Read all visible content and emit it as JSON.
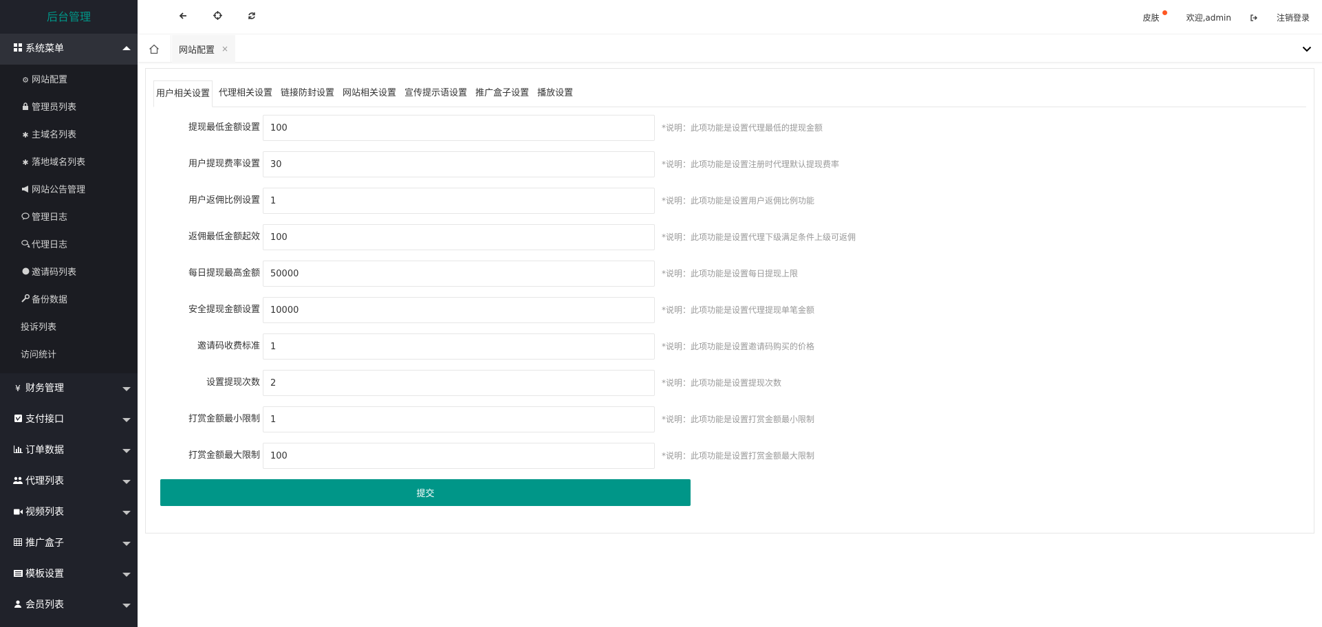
{
  "app": {
    "title": "后台管理"
  },
  "colors": {
    "accent": "#009688",
    "sidebar_bg": "#20222a",
    "badge": "#ff5722"
  },
  "sidebar": {
    "system_menu": {
      "label": "系统菜单",
      "icon": "grid-icon",
      "items": [
        {
          "label": "网站配置",
          "icon": "gears-icon"
        },
        {
          "label": "管理员列表",
          "icon": "lock-icon"
        },
        {
          "label": "主域名列表",
          "icon": "gear-icon"
        },
        {
          "label": "落地域名列表",
          "icon": "gear-icon"
        },
        {
          "label": "网站公告管理",
          "icon": "bullhorn-icon"
        },
        {
          "label": "管理日志",
          "icon": "comment-icon"
        },
        {
          "label": "代理日志",
          "icon": "comments-icon"
        },
        {
          "label": "邀请码列表",
          "icon": "circle-icon"
        },
        {
          "label": "备份数据",
          "icon": "wrench-icon"
        },
        {
          "label": "投诉列表",
          "icon": ""
        },
        {
          "label": "访问统计",
          "icon": ""
        }
      ]
    },
    "groups": [
      {
        "label": "财务管理",
        "icon": "yen-icon"
      },
      {
        "label": "支付接口",
        "icon": "vimeo-icon"
      },
      {
        "label": "订单数据",
        "icon": "bar-chart-icon"
      },
      {
        "label": "代理列表",
        "icon": "users-icon"
      },
      {
        "label": "视频列表",
        "icon": "video-camera-icon"
      },
      {
        "label": "推广盒子",
        "icon": "table-icon"
      },
      {
        "label": "模板设置",
        "icon": "list-alt-icon"
      },
      {
        "label": "会员列表",
        "icon": "user-icon"
      }
    ]
  },
  "header": {
    "back_icon": "arrow-left-icon",
    "crosshairs_icon": "crosshairs-icon",
    "refresh_icon": "refresh-icon",
    "skin_label": "皮肤",
    "welcome_label": "欢迎,admin",
    "logout_label": "注销登录"
  },
  "tabbar": {
    "home_icon": "home-icon",
    "active_tab": "网站配置",
    "close_glyph": "×"
  },
  "config": {
    "tabs": [
      "用户相关设置",
      "代理相关设置",
      "链接防封设置",
      "网站相关设置",
      "宣传提示语设置",
      "推广盒子设置",
      "播放设置"
    ],
    "active_tab_index": 0,
    "fields": [
      {
        "label": "提现最低金额设置",
        "value": "100",
        "tip": "*说明：此项功能是设置代理最低的提现金额"
      },
      {
        "label": "用户提现费率设置",
        "value": "30",
        "tip": "*说明：此项功能是设置注册时代理默认提现费率"
      },
      {
        "label": "用户返佣比例设置",
        "value": "1",
        "tip": "*说明：此项功能是设置用户返佣比例功能"
      },
      {
        "label": "返佣最低金额起效",
        "value": "100",
        "tip": "*说明：此项功能是设置代理下级满足条件上级可返佣"
      },
      {
        "label": "每日提现最高金额",
        "value": "50000",
        "tip": "*说明：此项功能是设置每日提现上限"
      },
      {
        "label": "安全提现金额设置",
        "value": "10000",
        "tip": "*说明：此项功能是设置代理提现单笔金额"
      },
      {
        "label": "邀请码收费标准",
        "value": "1",
        "tip": "*说明：此项功能是设置邀请码购买的价格"
      },
      {
        "label": "设置提现次数",
        "value": "2",
        "tip": "*说明：此项功能是设置提现次数"
      },
      {
        "label": "打赏金额最小限制",
        "value": "1",
        "tip": "*说明：此项功能是设置打赏金额最小限制"
      },
      {
        "label": "打赏金额最大限制",
        "value": "100",
        "tip": "*说明：此项功能是设置打赏金额最大限制"
      }
    ],
    "submit_label": "提交"
  }
}
